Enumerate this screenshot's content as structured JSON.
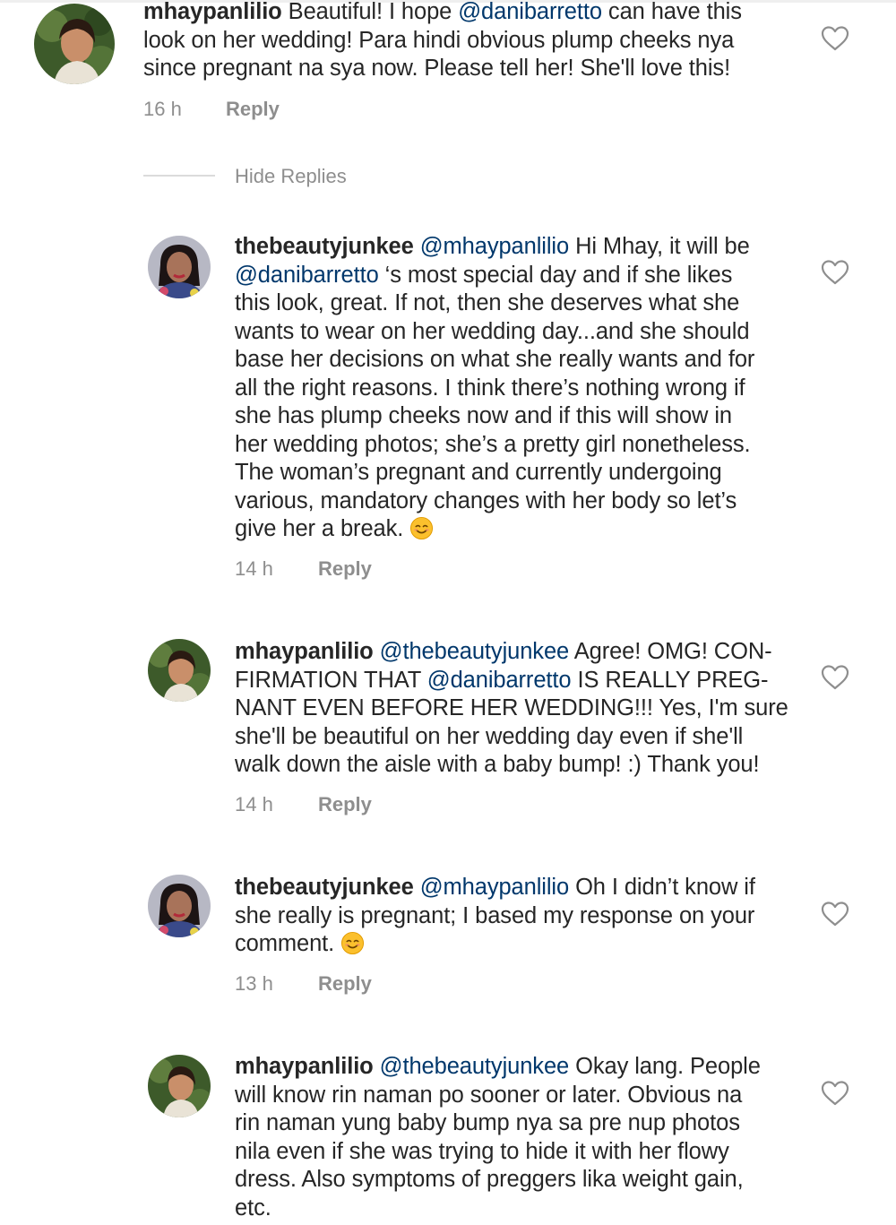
{
  "comments": [
    {
      "username": "mhaypanlilio",
      "segments": [
        {
          "t": "text",
          "v": " Beautiful! I hope "
        },
        {
          "t": "mention",
          "v": "@danibarretto"
        },
        {
          "t": "text",
          "v": " can have this\nlook on her wedding! Para hindi obvious plump cheeks nya\nsince pregnant na sya now. Please tell her! She'll love this!"
        }
      ],
      "time": "16 h",
      "reply_label": "Reply"
    },
    {
      "username": "thebeautyjunkee",
      "segments": [
        {
          "t": "text",
          "v": " "
        },
        {
          "t": "mention",
          "v": "@mhaypanlilio"
        },
        {
          "t": "text",
          "v": " Hi Mhay, it will be\n"
        },
        {
          "t": "mention",
          "v": "@danibarretto"
        },
        {
          "t": "text",
          "v": " ‘s most special day and if she likes\nthis look, great. If not, then she deserves what she\nwants to wear on her wedding day...and she should\nbase her decisions on what she really wants and for\nall the right reasons. I think there’s nothing wrong if\nshe has plump cheeks now and if this will show in\nher wedding photos; she’s a pretty girl nonetheless.\nThe woman’s pregnant and currently undergoing\nvarious, mandatory changes with her body so let’s\ngive her a break. "
        },
        {
          "t": "emoji",
          "v": "smiling-face-emoji"
        }
      ],
      "time": "14 h",
      "reply_label": "Reply"
    },
    {
      "username": "mhaypanlilio",
      "segments": [
        {
          "t": "text",
          "v": " "
        },
        {
          "t": "mention",
          "v": "@thebeautyjunkee"
        },
        {
          "t": "text",
          "v": " Agree! OMG! CON-\nFIRMATION THAT "
        },
        {
          "t": "mention",
          "v": "@danibarretto"
        },
        {
          "t": "text",
          "v": " IS REALLY PREG-\nNANT EVEN BEFORE HER WEDDING!!! Yes, I'm sure\nshe'll be beautiful on her wedding day even if she'll\nwalk down the aisle with a baby bump! :) Thank you!"
        }
      ],
      "time": "14 h",
      "reply_label": "Reply"
    },
    {
      "username": "thebeautyjunkee",
      "segments": [
        {
          "t": "text",
          "v": " "
        },
        {
          "t": "mention",
          "v": "@mhaypanlilio"
        },
        {
          "t": "text",
          "v": " Oh I didn’t know if\nshe really is pregnant; I based my response on your\ncomment. "
        },
        {
          "t": "emoji",
          "v": "smiling-face-emoji"
        }
      ],
      "time": "13 h",
      "reply_label": "Reply"
    },
    {
      "username": "mhaypanlilio",
      "segments": [
        {
          "t": "text",
          "v": " "
        },
        {
          "t": "mention",
          "v": "@thebeautyjunkee"
        },
        {
          "t": "text",
          "v": " Okay lang. People\nwill know rin naman po sooner or later. Obvious na\nrin naman yung baby bump nya sa pre nup photos\nnila even if she was trying to hide it with her flowy\ndress. Also symptoms of preggers lika weight gain,\netc."
        }
      ]
    }
  ],
  "hide_replies_label": "Hide Replies",
  "colors": {
    "text": "#262626",
    "mention": "#00376b",
    "meta": "#8e8e8e",
    "divider": "#dbdbdb"
  },
  "icons": {
    "like": "heart-outline-icon",
    "emoji": "smiling-face-emoji"
  }
}
